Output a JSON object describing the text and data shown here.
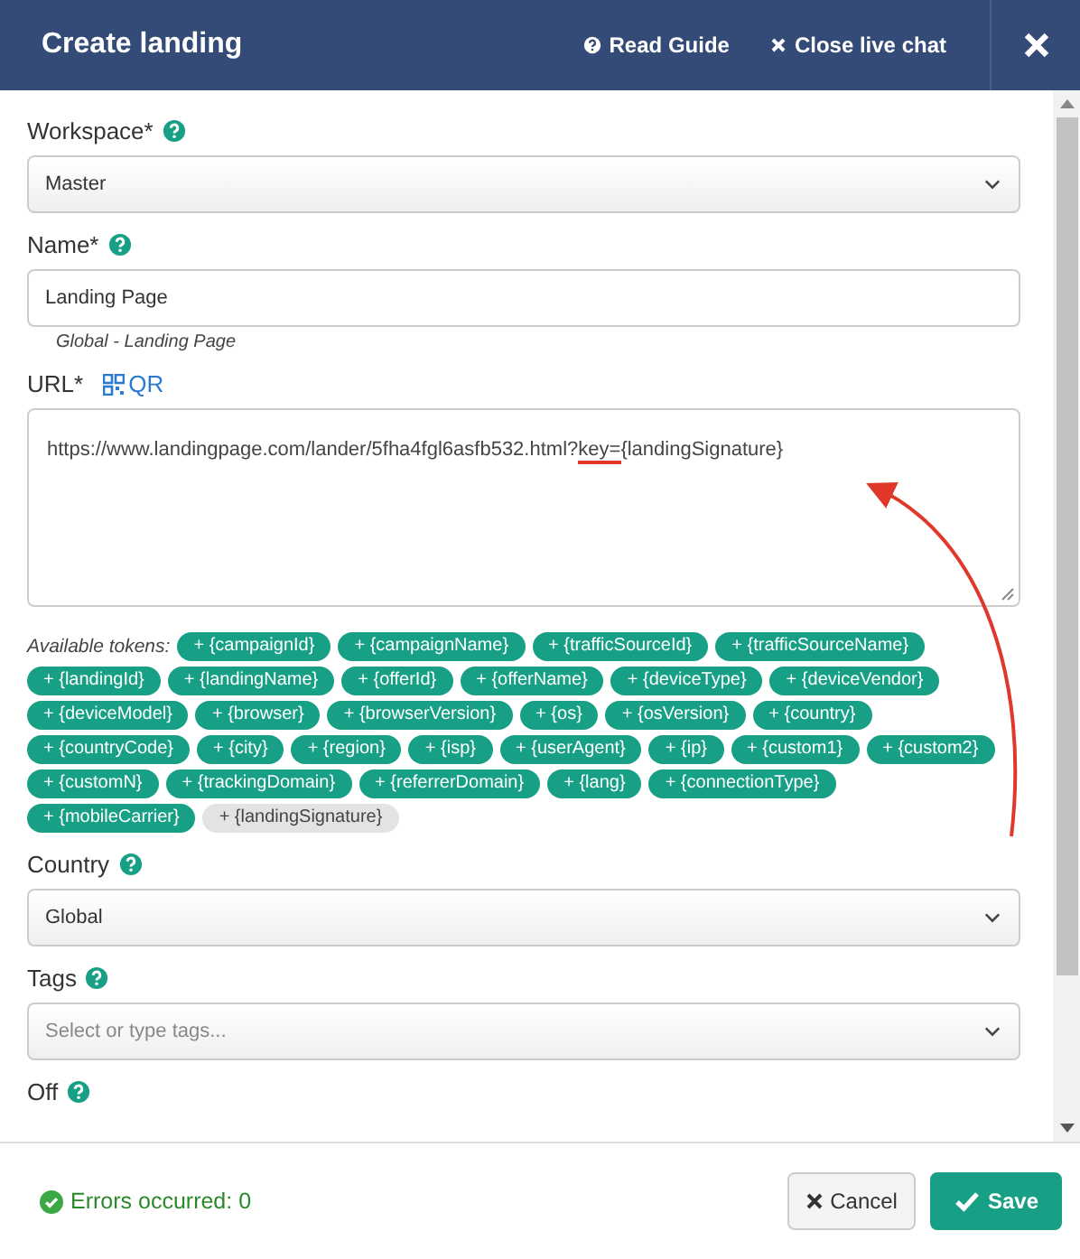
{
  "window": {
    "title": "Create landing",
    "links": [
      {
        "kind": "help",
        "label": "Read Guide"
      },
      {
        "kind": "close",
        "label": "Close live chat"
      }
    ]
  },
  "fields": [
    {
      "kind": "select",
      "label": "Workspace*",
      "help": true,
      "value": "Master"
    },
    {
      "kind": "input",
      "label": "Name*",
      "help": true,
      "value": "Landing Page",
      "hint": "Global - Landing Page"
    },
    {
      "kind": "url",
      "label": "URL*",
      "qr": "QR",
      "url": {
        "before": "https://www.landingpage.com/lander/5fha4fgl6asfb532.html?",
        "marked": "key=",
        "after": "{landingSignature}"
      },
      "tokens_label": "Available tokens:",
      "tokens": [
        {
          "label": "+ {campaignId}",
          "used": false
        },
        {
          "label": "+ {campaignName}",
          "used": false
        },
        {
          "label": "+ {trafficSourceId}",
          "used": false
        },
        {
          "label": "+ {trafficSourceName}",
          "used": false
        },
        {
          "label": "+ {landingId}",
          "used": false
        },
        {
          "label": "+ {landingName}",
          "used": false
        },
        {
          "label": "+ {offerId}",
          "used": false
        },
        {
          "label": "+ {offerName}",
          "used": false
        },
        {
          "label": "+ {deviceType}",
          "used": false
        },
        {
          "label": "+ {deviceVendor}",
          "used": false
        },
        {
          "label": "+ {deviceModel}",
          "used": false
        },
        {
          "label": "+ {browser}",
          "used": false
        },
        {
          "label": "+ {browserVersion}",
          "used": false
        },
        {
          "label": "+ {os}",
          "used": false
        },
        {
          "label": "+ {osVersion}",
          "used": false
        },
        {
          "label": "+ {country}",
          "used": false
        },
        {
          "label": "+ {countryCode}",
          "used": false
        },
        {
          "label": "+ {city}",
          "used": false
        },
        {
          "label": "+ {region}",
          "used": false
        },
        {
          "label": "+ {isp}",
          "used": false
        },
        {
          "label": "+ {userAgent}",
          "used": false
        },
        {
          "label": "+ {ip}",
          "used": false
        },
        {
          "label": "+ {custom1}",
          "used": false
        },
        {
          "label": "+ {custom2}",
          "used": false
        },
        {
          "label": "+ {customN}",
          "used": false
        },
        {
          "label": "+ {trackingDomain}",
          "used": false
        },
        {
          "label": "+ {referrerDomain}",
          "used": false
        },
        {
          "label": "+ {lang}",
          "used": false
        },
        {
          "label": "+ {connectionType}",
          "used": false
        },
        {
          "label": "+ {mobileCarrier}",
          "used": false
        },
        {
          "label": "+ {landingSignature}",
          "used": true
        }
      ]
    },
    {
      "kind": "select",
      "label": "Country",
      "help": true,
      "value": "Global"
    },
    {
      "kind": "select",
      "label": "Tags",
      "help": true,
      "placeholder": "Select or type tags..."
    },
    {
      "kind": "cut",
      "label": "Off",
      "help": true
    }
  ],
  "footer": {
    "status": "Errors occurred: 0",
    "buttons": [
      {
        "kind": "cancel",
        "label": "Cancel"
      },
      {
        "kind": "save",
        "label": "Save"
      }
    ]
  }
}
